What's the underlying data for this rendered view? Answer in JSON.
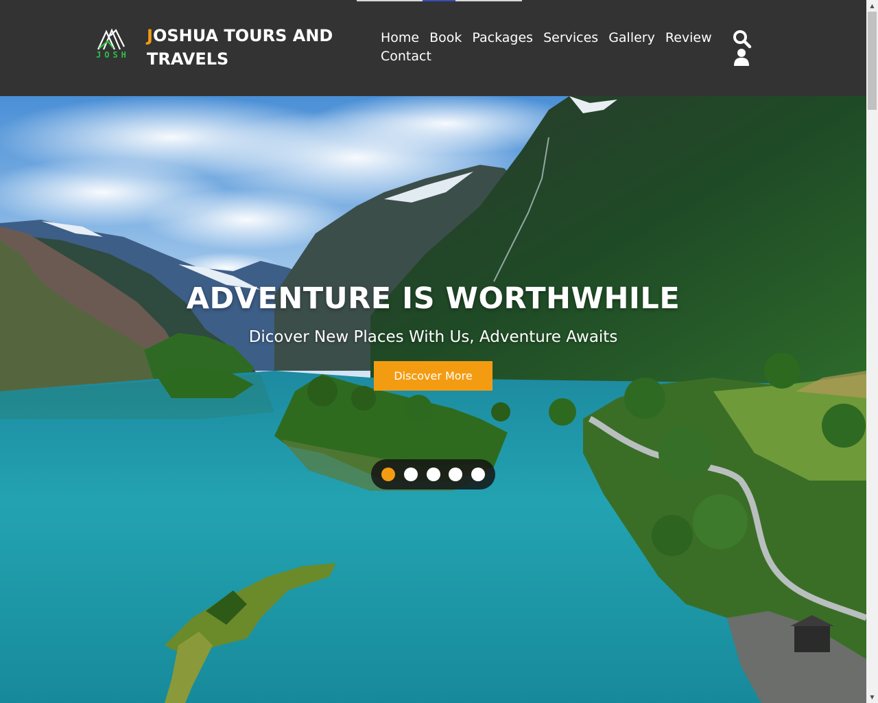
{
  "header": {
    "logo_text": "JOSH",
    "brand_first_letter": "J",
    "brand_rest_line1": "OSHUA TOURS AND",
    "brand_line2": "TRAVELS",
    "nav": [
      "Home",
      "Book",
      "Packages",
      "Services",
      "Gallery",
      "Review",
      "Contact"
    ],
    "search_icon": "search-icon",
    "user_icon": "user-icon"
  },
  "hero": {
    "title": "ADVENTURE IS WORTHWHILE",
    "subtitle": "Dicover New Places With Us, Adventure Awaits",
    "button_label": "Discover More",
    "slides": 5,
    "active_slide": 1
  },
  "colors": {
    "accent": "#f39c12",
    "header_bg": "#333333",
    "text": "#ffffff",
    "logo_green": "#2fbf4a"
  }
}
